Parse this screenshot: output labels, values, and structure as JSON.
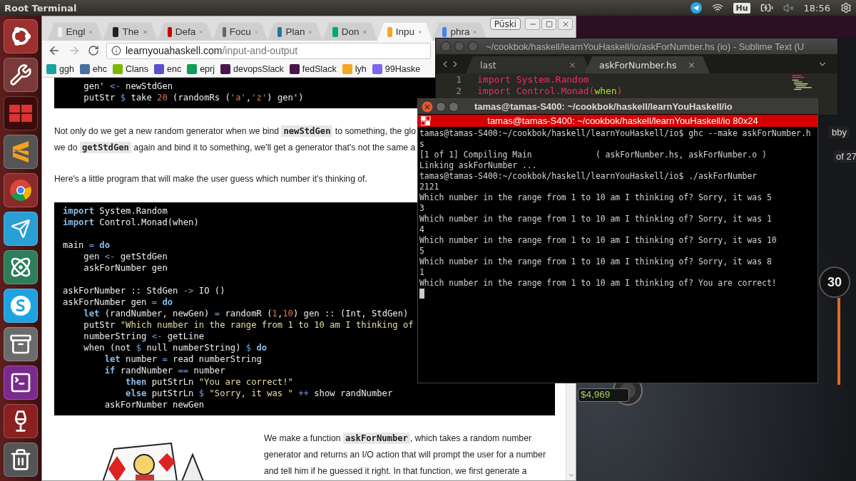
{
  "top_panel": {
    "title": "Root Terminal",
    "keyboard_layout": "Hu",
    "clock": "18:56"
  },
  "browser": {
    "profile": "Püski",
    "tabs": [
      {
        "label": "Engl",
        "selected": false
      },
      {
        "label": "The",
        "selected": false
      },
      {
        "label": "Defa",
        "selected": false
      },
      {
        "label": "Focu",
        "selected": false
      },
      {
        "label": "Plan",
        "selected": false
      },
      {
        "label": "Don",
        "selected": false
      },
      {
        "label": "Inpu",
        "selected": true
      },
      {
        "label": "phra",
        "selected": false
      }
    ],
    "address": {
      "host": "learnyouahaskell.com",
      "path": "/input-and-output"
    },
    "bookmarks": [
      "ggh",
      "ehc",
      "Clans",
      "enc",
      "eprj",
      "devopsSlack",
      "fedSlack",
      "lyh",
      "99Haske"
    ],
    "content": [
      {
        "kind": "code",
        "groups": [
          [
            [
              {
                "text": "    gen' "
              },
              {
                "text": "<-",
                "kind": "op"
              },
              {
                "text": " newStdGen"
              }
            ],
            [
              {
                "text": "    putStr "
              },
              {
                "text": "$",
                "kind": "op"
              },
              {
                "text": " take "
              },
              {
                "text": "20",
                "kind": "num"
              },
              {
                "text": " (randomRs ("
              },
              {
                "text": "'a'",
                "kind": "num"
              },
              {
                "text": ","
              },
              {
                "text": "'z'",
                "kind": "num"
              },
              {
                "text": ") gen')"
              }
            ]
          ]
        ]
      },
      {
        "kind": "paragraph",
        "lines": [
          [
            {
              "text": "Not only do we get a new random generator when we bind "
            },
            {
              "text": "newStdGen",
              "kind": "code"
            },
            {
              "text": " to something, the glo"
            }
          ],
          [
            {
              "text": "we do "
            },
            {
              "text": "getStdGen",
              "kind": "code"
            },
            {
              "text": " again and bind it to something, we'll get a generator that's not the same a"
            }
          ]
        ]
      },
      {
        "kind": "paragraph",
        "lines": [
          [
            {
              "text": "Here's a little program that will make the user guess which number it's thinking of."
            }
          ]
        ]
      },
      {
        "kind": "code",
        "groups": [
          [
            [
              {
                "text": "import",
                "kind": "kw"
              },
              {
                "text": " System.Random"
              }
            ],
            [
              {
                "text": "import",
                "kind": "kw"
              },
              {
                "text": " Control.Monad(when)"
              }
            ]
          ],
          [
            [
              {
                "text": "main "
              },
              {
                "text": "=",
                "kind": "op"
              },
              {
                "text": " do",
                "kind": "kw"
              }
            ],
            [
              {
                "text": "    gen "
              },
              {
                "text": "<-",
                "kind": "op"
              },
              {
                "text": " getStdGen"
              }
            ],
            [
              {
                "text": "    askForNumber gen"
              }
            ]
          ],
          [
            [
              {
                "text": "askForNumber :: StdGen "
              },
              {
                "text": "->",
                "kind": "op"
              },
              {
                "text": " IO ()"
              }
            ],
            [
              {
                "text": "askForNumber gen "
              },
              {
                "text": "=",
                "kind": "op"
              },
              {
                "text": " do",
                "kind": "kw"
              }
            ],
            [
              {
                "text": "    let",
                "kind": "kw"
              },
              {
                "text": " (randNumber, newGen) "
              },
              {
                "text": "=",
                "kind": "op"
              },
              {
                "text": " randomR ("
              },
              {
                "text": "1",
                "kind": "num"
              },
              {
                "text": ","
              },
              {
                "text": "10",
                "kind": "num"
              },
              {
                "text": ") gen :: (Int, StdGen)"
              }
            ],
            [
              {
                "text": "    putStr "
              },
              {
                "text": "\"Which number in the range from 1 to 10 am I thinking of",
                "kind": "str"
              }
            ],
            [
              {
                "text": "    numberString "
              },
              {
                "text": "<-",
                "kind": "op"
              },
              {
                "text": " getLine"
              }
            ],
            [
              {
                "text": "    when (not "
              },
              {
                "text": "$",
                "kind": "op"
              },
              {
                "text": " null numberString) "
              },
              {
                "text": "$",
                "kind": "op"
              },
              {
                "text": " do",
                "kind": "kw"
              }
            ],
            [
              {
                "text": "        let",
                "kind": "kw"
              },
              {
                "text": " number "
              },
              {
                "text": "=",
                "kind": "op"
              },
              {
                "text": " read numberString"
              }
            ],
            [
              {
                "text": "        if",
                "kind": "kw"
              },
              {
                "text": " randNumber "
              },
              {
                "text": "==",
                "kind": "op"
              },
              {
                "text": " number"
              }
            ],
            [
              {
                "text": "            then",
                "kind": "kw"
              },
              {
                "text": " putStrLn "
              },
              {
                "text": "\"You are correct!\"",
                "kind": "str"
              }
            ],
            [
              {
                "text": "            else",
                "kind": "kw"
              },
              {
                "text": " putStrLn "
              },
              {
                "text": "$",
                "kind": "op"
              },
              {
                "text": " \"Sorry, it was \"",
                "kind": "str"
              },
              {
                "text": " ++",
                "kind": "op"
              },
              {
                "text": " show randNumber"
              }
            ],
            [
              {
                "text": "        askForNumber newGen"
              }
            ]
          ]
        ]
      },
      {
        "kind": "figure",
        "lines": [
          [
            {
              "text": "We make a function "
            },
            {
              "text": "askForNumber",
              "kind": "code"
            },
            {
              "text": ", which takes a random number"
            }
          ],
          [
            {
              "text": "generator and returns an I/O action that will prompt the user for a number"
            }
          ],
          [
            {
              "text": "and tell him if he guessed it right. In that function, we first generate a"
            }
          ]
        ]
      }
    ]
  },
  "sublime": {
    "title": "~/cookbok/haskell/learnYouHaskell/io/askForNumber.hs (io) - Sublime Text (U",
    "tabs": [
      {
        "label": "last",
        "selected": false
      },
      {
        "label": "askForNumber.hs",
        "selected": true
      }
    ],
    "lines": [
      {
        "number": "1",
        "tokens": [
          {
            "text": "import System.Random",
            "kind": "keyword"
          }
        ]
      },
      {
        "number": "2",
        "tokens": [
          {
            "text": "import Control.Monad(",
            "kind": "keyword"
          },
          {
            "text": "when",
            "kind": "function"
          },
          {
            "text": ")",
            "kind": "keyword"
          }
        ]
      }
    ]
  },
  "terminal": {
    "title": "tamas@tamas-S400: ~/cookbok/haskell/learnYouHaskell/io",
    "tab_title": "tamas@tamas-S400: ~/cookbok/haskell/learnYouHaskell/io 80x24",
    "lines": [
      "tamas@tamas-S400:~/cookbok/haskell/learnYouHaskell/io$ ghc --make askForNumber.h",
      "s",
      "[1 of 1] Compiling Main             ( askForNumber.hs, askForNumber.o )",
      "Linking askForNumber ...",
      "tamas@tamas-S400:~/cookbok/haskell/learnYouHaskell/io$ ./askForNumber",
      "2121",
      "Which number in the range from 1 to 10 am I thinking of? Sorry, it was 5",
      "3",
      "Which number in the range from 1 to 10 am I thinking of? Sorry, it was 1",
      "4",
      "Which number in the range from 1 to 10 am I thinking of? Sorry, it was 10",
      "5",
      "Which number in the range from 1 to 10 am I thinking of? Sorry, it was 8",
      "1",
      "Which number in the range from 1 to 10 am I thinking of? You are correct!"
    ]
  },
  "game_window": {
    "label_1": "bby",
    "label_2": "of 27",
    "label_3": "30",
    "chips": "$4,969"
  }
}
